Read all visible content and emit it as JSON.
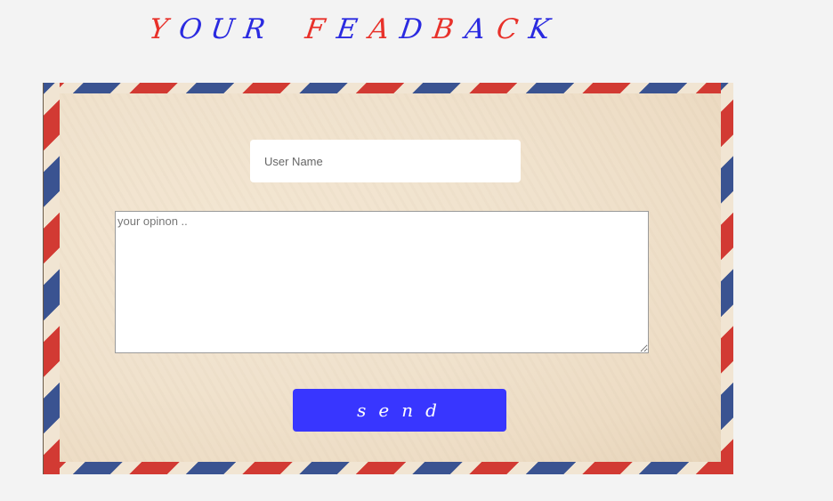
{
  "header": {
    "title_letters": [
      {
        "char": "Y",
        "color": "#e8312a"
      },
      {
        "char": "O",
        "color": "#2a2ae0"
      },
      {
        "char": "U",
        "color": "#2a2ae0"
      },
      {
        "char": "R",
        "color": "#2a2ae0"
      },
      {
        "char": " ",
        "color": "#000000"
      },
      {
        "char": "F",
        "color": "#e8312a"
      },
      {
        "char": "E",
        "color": "#2a2ae0"
      },
      {
        "char": "A",
        "color": "#e8312a"
      },
      {
        "char": "D",
        "color": "#2a2ae0"
      },
      {
        "char": "B",
        "color": "#e8312a"
      },
      {
        "char": "A",
        "color": "#2a2ae0"
      },
      {
        "char": "C",
        "color": "#e8312a"
      },
      {
        "char": "K",
        "color": "#2a2ae0"
      }
    ]
  },
  "form": {
    "username": {
      "placeholder": "User Name",
      "value": ""
    },
    "opinion": {
      "placeholder": "your opinon ..",
      "value": ""
    },
    "send_label": "send"
  },
  "colors": {
    "page_bg": "#f3f3f3",
    "button_bg": "#3836ff",
    "stripe_red": "#d23a33",
    "stripe_blue": "#3a5391"
  }
}
